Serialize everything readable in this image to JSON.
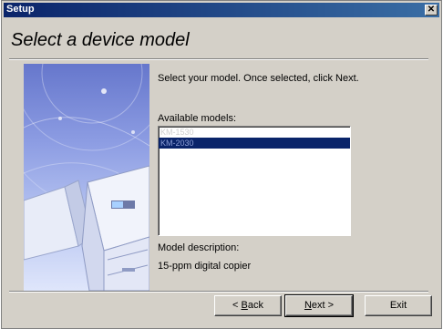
{
  "window": {
    "title": "Setup",
    "close_glyph": "✕"
  },
  "page": {
    "heading": "Select a device model",
    "instruction": "Select your model. Once selected, click Next.",
    "models_label": "Available models:",
    "models": [
      {
        "label": "KM-1530",
        "selected": false
      },
      {
        "label": "KM-2030",
        "selected": true
      }
    ],
    "description_label": "Model description:",
    "description_value": "15-ppm digital copier"
  },
  "buttons": {
    "back": {
      "prefix": "< ",
      "accel": "B",
      "rest": "ack"
    },
    "next": {
      "accel": "N",
      "rest": "ext >"
    },
    "exit": "Exit"
  },
  "colors": {
    "title_bar": "#0a246a",
    "dialog_face": "#d4d0c8",
    "selection": "#0a246a"
  },
  "icons": {
    "close": "close-icon",
    "illustration": "printer-copier-illustration"
  }
}
